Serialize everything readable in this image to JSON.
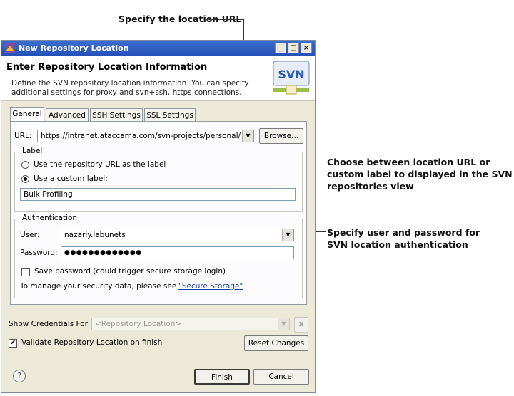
{
  "annotations": {
    "top": "Specify the location URL",
    "label_group": [
      "Choose between location URL or",
      "custom label to displayed in the SVN",
      "repositories view"
    ],
    "auth_group": [
      "Specify user and password for",
      "SVN location authentication"
    ]
  },
  "window": {
    "title": "New Repository Location",
    "minimize": "_",
    "maximize": "□",
    "close": "×"
  },
  "header": {
    "title": "Enter Repository Location Information",
    "description": "Define the SVN repository location information. You can specify additional settings for proxy and svn+ssh, https connections.",
    "logo_text": "SVN"
  },
  "tabs": [
    "General",
    "Advanced",
    "SSH Settings",
    "SSL Settings"
  ],
  "url": {
    "label": "URL:",
    "value": "https://intranet.ataccama.com/svn-projects/personal/",
    "browse": "Browse..."
  },
  "label_group": {
    "title": "Label",
    "option_url": "Use the repository URL as the label",
    "option_custom": "Use a custom label:",
    "custom_value": "Bulk Profiling"
  },
  "auth": {
    "title": "Authentication",
    "user_label": "User:",
    "user_value": "nazariy.labunets",
    "password_label": "Password:",
    "password_value": "●●●●●●●●●●●●●",
    "save_password": "Save password (could trigger secure storage login)",
    "manage_prefix": "To manage your security data, please see ",
    "manage_link": "\"Secure Storage\""
  },
  "credentials": {
    "label": "Show Credentials For:",
    "placeholder": "<Repository Location>"
  },
  "validate": {
    "label": "Validate Repository Location on finish",
    "checked": true,
    "reset": "Reset Changes"
  },
  "footer": {
    "help": "?",
    "finish": "Finish",
    "cancel": "Cancel"
  }
}
